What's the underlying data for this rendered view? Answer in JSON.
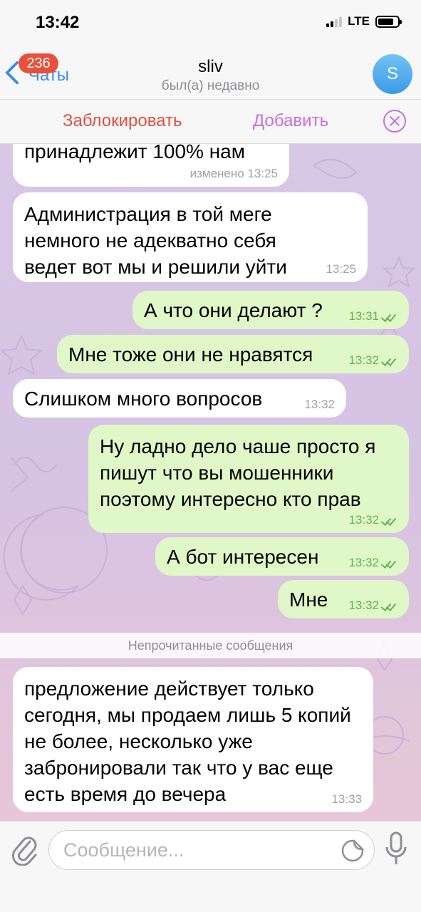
{
  "status_bar": {
    "time": "13:42",
    "network": "LTE"
  },
  "header": {
    "back_label": "Чаты",
    "unread_badge": "236",
    "title": "sliv",
    "subtitle": "был(а) недавно",
    "avatar_letter": "S"
  },
  "actions": {
    "block_label": "Заблокировать",
    "add_label": "Добавить"
  },
  "messages": [
    {
      "direction": "in",
      "text": "принадлежит 100% нам",
      "time": "изменено 13:25"
    },
    {
      "direction": "in",
      "text": "Администрация в той меге немного не адекватно себя ведет вот мы и решили уйти",
      "time": "13:25"
    },
    {
      "direction": "out",
      "text": "А что они делают ?",
      "time": "13:31"
    },
    {
      "direction": "out",
      "text": "Мне тоже они не нравятся",
      "time": "13:32"
    },
    {
      "direction": "in",
      "text": "Слишком много вопросов",
      "time": "13:32"
    },
    {
      "direction": "out",
      "text": "Ну ладно дело чаше просто я пишут что вы мошенники поэтому интересно кто прав",
      "time": "13:32"
    },
    {
      "direction": "out",
      "text": "А бот интересен",
      "time": "13:32"
    },
    {
      "direction": "out",
      "text": "Мне",
      "time": "13:32"
    },
    {
      "direction": "in",
      "text": "предложение действует только сегодня, мы продаем лишь 5 копий не более, несколько уже забронировали так что у вас еще есть время до вечера",
      "time": "13:33"
    }
  ],
  "unread_divider": "Непрочитанные сообщения",
  "composer": {
    "placeholder": "Сообщение..."
  },
  "colors": {
    "accent_blue": "#3a8de6",
    "block_red": "#e0503e",
    "add_purple": "#c86fe0",
    "outgoing_bubble": "#e0f7c8",
    "incoming_bubble": "#ffffff"
  },
  "icons": [
    "chevron-left-icon",
    "close-circle-icon",
    "paperclip-icon",
    "sticker-icon",
    "microphone-icon",
    "read-ticks-icon"
  ]
}
